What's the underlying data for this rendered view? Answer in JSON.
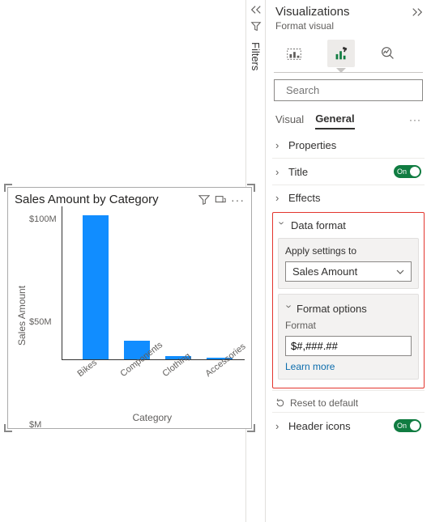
{
  "filters_rail": {
    "label": "Filters"
  },
  "pane": {
    "title": "Visualizations",
    "subtitle": "Format visual",
    "search_placeholder": "Search",
    "tabs": {
      "visual": "Visual",
      "general": "General"
    },
    "sections": {
      "properties": "Properties",
      "title": "Title",
      "effects": "Effects",
      "data_format": "Data format",
      "header_icons": "Header icons"
    },
    "toggle_on": "On",
    "data_format": {
      "apply_label": "Apply settings to",
      "apply_value": "Sales Amount",
      "format_options_header": "Format options",
      "format_label": "Format",
      "format_value": "$#,###.##",
      "learn_more": "Learn more"
    },
    "reset_label": "Reset to default"
  },
  "chart": {
    "title": "Sales Amount by Category",
    "yticks": {
      "100": "$100M",
      "50": "$50M",
      "0": "$M"
    },
    "y_axis_label": "Sales Amount",
    "x_axis_label": "Category"
  },
  "chart_data": {
    "type": "bar",
    "title": "Sales Amount by Category",
    "xlabel": "Category",
    "ylabel": "Sales Amount",
    "ylim": [
      0,
      100
    ],
    "y_unit": "$M",
    "categories": [
      "Bikes",
      "Components",
      "Clothing",
      "Accessories"
    ],
    "values": [
      94,
      12,
      2,
      1
    ]
  }
}
